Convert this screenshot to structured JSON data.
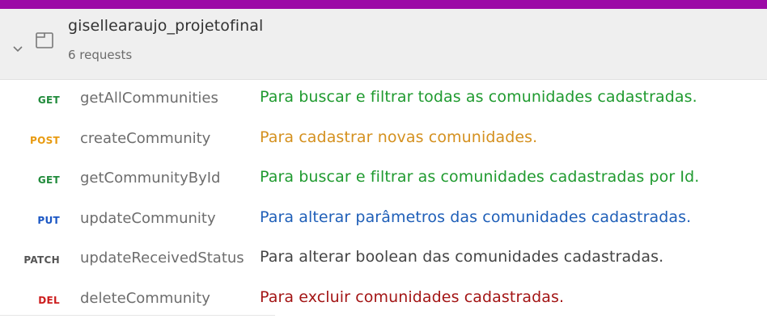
{
  "collection": {
    "name": "gisellearaujo_projetofinal",
    "count": "6 requests"
  },
  "requests": [
    {
      "method": "GET",
      "method_color": "#1f8a3a",
      "name": "getAllCommunities",
      "description": "Para buscar e filtrar todas as comunidades cadastradas.",
      "desc_color": "#1f9a2f"
    },
    {
      "method": "POST",
      "method_color": "#e89a10",
      "name": "createCommunity",
      "description": "Para cadastrar novas comunidades.",
      "desc_color": "#d4901e"
    },
    {
      "method": "GET",
      "method_color": "#1f8a3a",
      "name": "getCommunityById",
      "description": "Para buscar e filtrar as comunidades cadastradas por Id.",
      "desc_color": "#1f9a2f"
    },
    {
      "method": "PUT",
      "method_color": "#1a56c4",
      "name": "updateCommunity",
      "description": "Para alterar parâmetros das comunidades cadastradas.",
      "desc_color": "#1f5fb8"
    },
    {
      "method": "PATCH",
      "method_color": "#555555",
      "name": "updateReceivedStatus",
      "description": "Para alterar boolean das comunidades cadastradas.",
      "desc_color": "#444444"
    },
    {
      "method": "DEL",
      "method_color": "#cc1d1d",
      "name": "deleteCommunity",
      "description": "Para excluir comunidades cadastradas.",
      "desc_color": "#a31515"
    }
  ],
  "colors": {
    "top_bar": "#9c0aa6",
    "header_bg": "#efefef"
  }
}
